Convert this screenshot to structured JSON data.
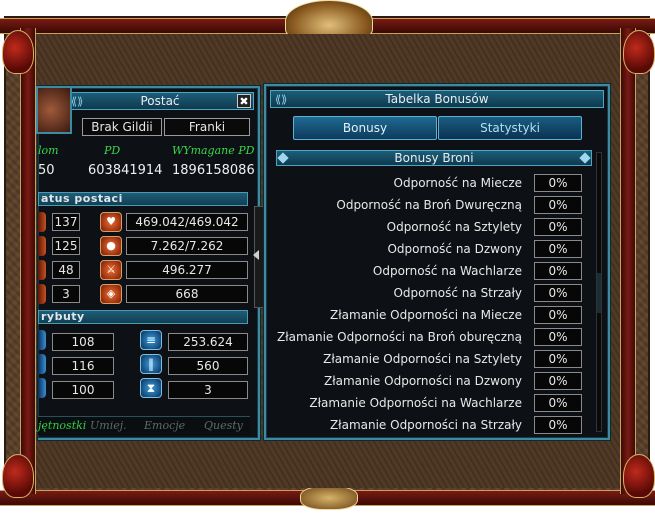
{
  "character_window": {
    "title": "Postać",
    "guild": "Brak Gildii",
    "name": "Franki",
    "labels": {
      "left": "lom",
      "middle": "PD",
      "right": "WYmagane PD"
    },
    "values": {
      "left": "50",
      "middle": "603841914",
      "right": "1896158086"
    },
    "status_header": "atus postaci",
    "status_rows": [
      {
        "left": "137",
        "right": "469.042/469.042",
        "icon": "heart-icon"
      },
      {
        "left": "125",
        "right": "7.262/7.262",
        "icon": "mana-orb-icon"
      },
      {
        "left": "48",
        "right": "496.277",
        "icon": "attack-icon"
      },
      {
        "left": "3",
        "right": "668",
        "icon": "shield-icon"
      }
    ],
    "attributes_header": "rybuty",
    "attribute_rows": [
      {
        "left": "108",
        "right": "253.624",
        "icon": "magic-attack-icon"
      },
      {
        "left": "116",
        "right": "560",
        "icon": "magic-defense-icon"
      },
      {
        "left": "100",
        "right": "3",
        "icon": "hourglass-icon"
      }
    ],
    "tabs": [
      "jętnostki",
      "Umiej.",
      "Emocje",
      "Questy"
    ],
    "active_tab": 0
  },
  "bonus_window": {
    "title": "Tabelka Bonusów",
    "tabs": [
      "Bonusy",
      "Statystyki"
    ],
    "selected_tab": 0,
    "section_title": "Bonusy Broni",
    "rows": [
      {
        "label": "Odporność na Miecze",
        "value": "0%"
      },
      {
        "label": "Odporność na Broń Dwuręczną",
        "value": "0%"
      },
      {
        "label": "Odporność na Sztylety",
        "value": "0%"
      },
      {
        "label": "Odporność na Dzwony",
        "value": "0%"
      },
      {
        "label": "Odporność na Wachlarze",
        "value": "0%"
      },
      {
        "label": "Odporność na Strzały",
        "value": "0%"
      },
      {
        "label": "Złamanie Odporności na Miecze",
        "value": "0%"
      },
      {
        "label": "Złamanie Odporności na Broń oburęczną",
        "value": "0%"
      },
      {
        "label": "Złamanie Odporności na Sztylety",
        "value": "0%"
      },
      {
        "label": "Złamanie Odporności na Dzwony",
        "value": "0%"
      },
      {
        "label": "Złamanie Odporności na Wachlarze",
        "value": "0%"
      },
      {
        "label": "Złamanie Odporności na Strzały",
        "value": "0%"
      }
    ]
  },
  "colors": {
    "accent": "#3e8aa0",
    "green_text": "#39d84a",
    "frame_red": "#7a1a14",
    "frame_gold": "#c9a25a"
  }
}
